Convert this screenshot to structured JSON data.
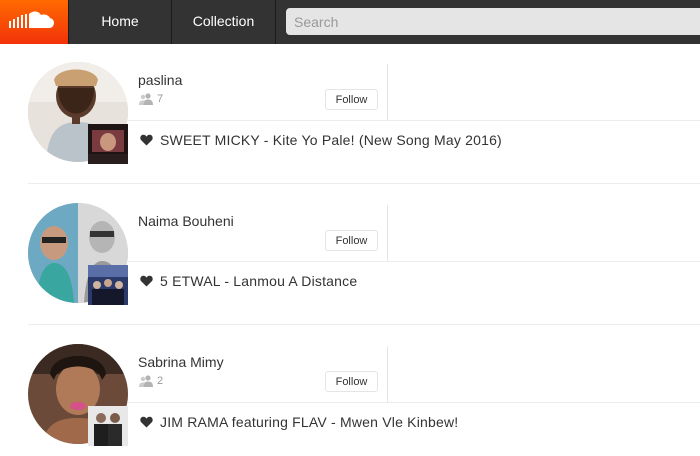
{
  "header": {
    "logo_icon": "soundcloud-logo-icon",
    "nav": [
      {
        "label": "Home"
      },
      {
        "label": "Collection"
      }
    ],
    "search": {
      "placeholder": "Search",
      "value": ""
    }
  },
  "items": [
    {
      "user": "paslina",
      "followers": "7",
      "follow_label": "Follow",
      "track": "SWEET MICKY - Kite Yo Pale! (New Song May 2016)"
    },
    {
      "user": "Naima Bouheni",
      "followers": "",
      "follow_label": "Follow",
      "track": "5 ETWAL - Lanmou A Distance"
    },
    {
      "user": "Sabrina Mimy",
      "followers": "2",
      "follow_label": "Follow",
      "track": "JIM RAMA featuring FLAV - Mwen Vle Kinbew!"
    }
  ],
  "icons": {
    "followers": "followers-icon",
    "like": "heart-icon"
  },
  "colors": {
    "brand_orange": "#ff5500",
    "header_bg": "#333333"
  }
}
